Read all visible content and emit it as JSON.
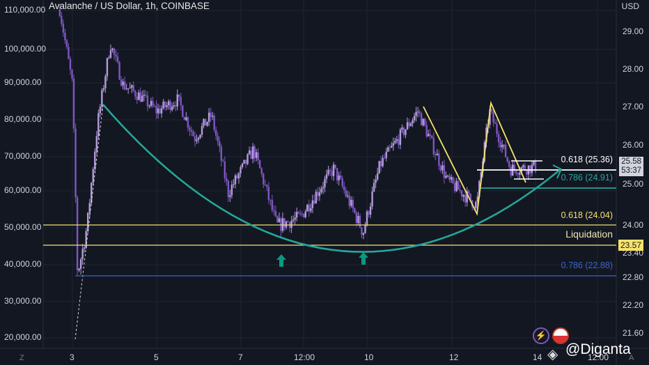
{
  "header": {
    "title": "Avalanche / US Dollar, 1h, COINBASE",
    "currency": "USD"
  },
  "left_axis": [
    "110,000.00",
    "100,000.00",
    "90,000.00",
    "80,000.00",
    "70,000.00",
    "60,000.00",
    "50,000.00",
    "40,000.00",
    "30,000.00",
    "20,000.00"
  ],
  "right_axis": [
    "29.00",
    "28.00",
    "27.00",
    "26.00",
    "25.00",
    "24.00",
    "23.40",
    "22.80",
    "22.20",
    "21.60"
  ],
  "time_axis": [
    "3",
    "5",
    "7",
    "12:00",
    "10",
    "12",
    "14",
    "12:00"
  ],
  "time_axis_extra": {
    "left_badge": "Z",
    "right_badge": "A"
  },
  "fib_labels": {
    "upper_618": "0.618 (25.36)",
    "upper_786": "0.786 (24.91)",
    "lower_618": "0.618 (24.04)",
    "lower_786": "0.786 (22.88)",
    "liquidation": "Liquidation"
  },
  "price_badge": {
    "price": "25.58",
    "countdown": "53:37"
  },
  "liquidation_badge": "23.57",
  "watermark": "@Diganta",
  "colors": {
    "up": "#b39ddb",
    "down": "#7e57c2",
    "teal": "#26a69a",
    "yellow": "#f7e36b",
    "blue": "#3d63c9",
    "white": "#ffffff",
    "arrow": "#089981"
  },
  "price_path": [
    {
      "t": -0.3,
      "p": 29.6
    },
    {
      "t": 0.0,
      "p": 27.6
    },
    {
      "t": 0.12,
      "p": 22.9
    },
    {
      "t": 0.35,
      "p": 24.0
    },
    {
      "t": 0.6,
      "p": 26.6
    },
    {
      "t": 0.9,
      "p": 28.7
    },
    {
      "t": 1.2,
      "p": 27.6
    },
    {
      "t": 1.6,
      "p": 27.3
    },
    {
      "t": 2.0,
      "p": 26.9
    },
    {
      "t": 2.5,
      "p": 27.2
    },
    {
      "t": 2.9,
      "p": 26.2
    },
    {
      "t": 3.3,
      "p": 26.8
    },
    {
      "t": 3.7,
      "p": 24.8
    },
    {
      "t": 4.3,
      "p": 25.9
    },
    {
      "t": 4.85,
      "p": 24.0
    },
    {
      "t": 5.4,
      "p": 24.2
    },
    {
      "t": 6.2,
      "p": 25.4
    },
    {
      "t": 6.9,
      "p": 23.85
    },
    {
      "t": 7.3,
      "p": 25.5
    },
    {
      "t": 8.2,
      "p": 26.9
    },
    {
      "t": 8.9,
      "p": 25.1
    },
    {
      "t": 9.6,
      "p": 24.5
    },
    {
      "t": 9.9,
      "p": 26.9
    },
    {
      "t": 10.4,
      "p": 25.4
    },
    {
      "t": 11.0,
      "p": 25.45
    }
  ]
}
